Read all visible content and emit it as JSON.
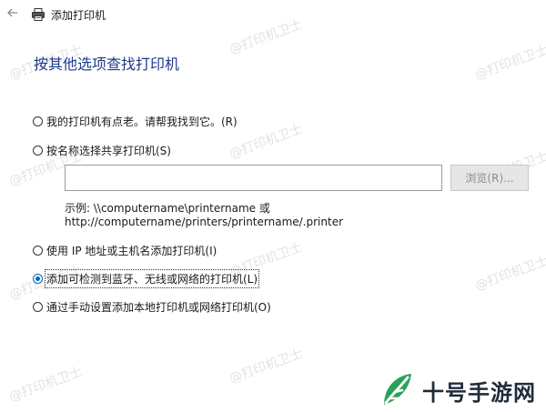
{
  "window": {
    "title": "添加打印机"
  },
  "heading": "按其他选项查找打印机",
  "options": [
    {
      "label": "我的打印机有点老。请帮我找到它。(R)",
      "checked": false
    },
    {
      "label": "按名称选择共享打印机(S)",
      "checked": false
    },
    {
      "label": "使用 IP 地址或主机名添加打印机(I)",
      "checked": false
    },
    {
      "label": "添加可检测到蓝牙、无线或网络的打印机(L)",
      "checked": true
    },
    {
      "label": "通过手动设置添加本地打印机或网络打印机(O)",
      "checked": false
    }
  ],
  "share_input": {
    "value": ""
  },
  "browse_button": "浏览(R)...",
  "example": {
    "line1": "示例: \\\\computername\\printername 或",
    "line2": "http://computername/printers/printername/.printer"
  },
  "watermark": "@打印机卫士",
  "brand": {
    "name": "十号手游网",
    "colors": {
      "primary": "#2aa15a",
      "text": "#1f2b3a"
    }
  },
  "colors": {
    "heading": "#1f3a8a",
    "radio_selected": "#0067c0"
  },
  "icons": {
    "back": "back-arrow-icon",
    "printer": "printer-icon",
    "brand": "leaf-logo-icon"
  }
}
